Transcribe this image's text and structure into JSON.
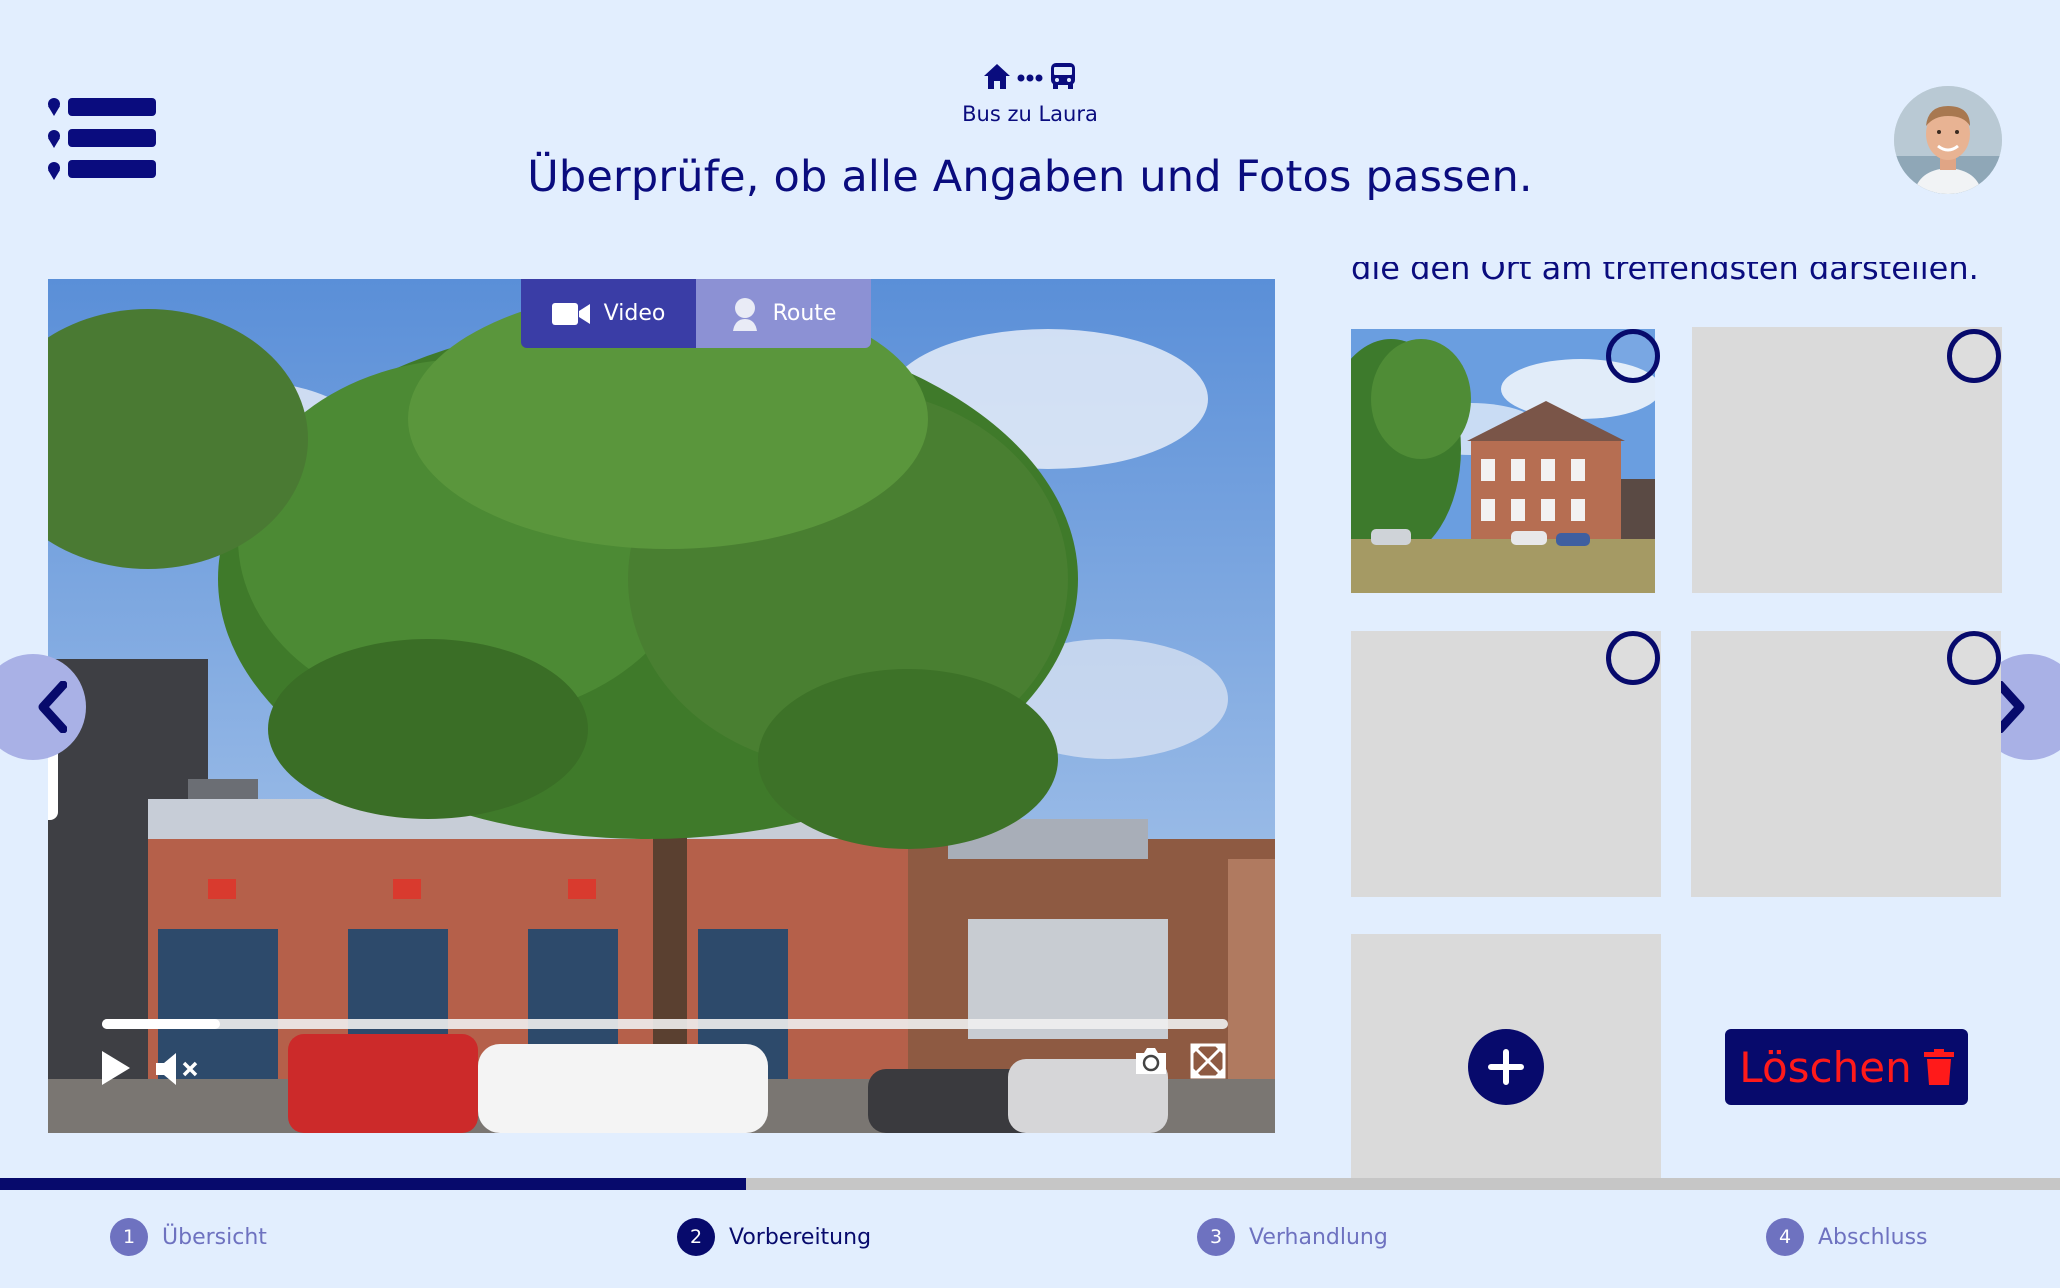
{
  "header": {
    "journey_label": "Bus zu Laura",
    "title": "Überprüfe, ob alle Angaben und Fotos passen."
  },
  "media": {
    "tabs": [
      {
        "label": "Video",
        "icon": "video-camera-icon",
        "active": true
      },
      {
        "label": "Route",
        "icon": "person-pin-icon",
        "active": false
      }
    ],
    "playback_progress": 0.105
  },
  "photos": {
    "intro_text": "die den Ort am treffendsten darstellen.",
    "delete_label": "Löschen"
  },
  "progress": {
    "overall_fraction": 0.362
  },
  "steps": [
    {
      "number": "1",
      "label": "Übersicht",
      "active": false
    },
    {
      "number": "2",
      "label": "Vorbereitung",
      "active": true
    },
    {
      "number": "3",
      "label": "Verhandlung",
      "active": false
    },
    {
      "number": "4",
      "label": "Abschluss",
      "active": false
    }
  ],
  "colors": {
    "background": "#e2eefe",
    "primary": "#070a6c",
    "tab_active": "#3a3da6",
    "tab_inactive": "#8c91d4",
    "danger": "#ff1a1a",
    "placeholder": "#dadada"
  }
}
